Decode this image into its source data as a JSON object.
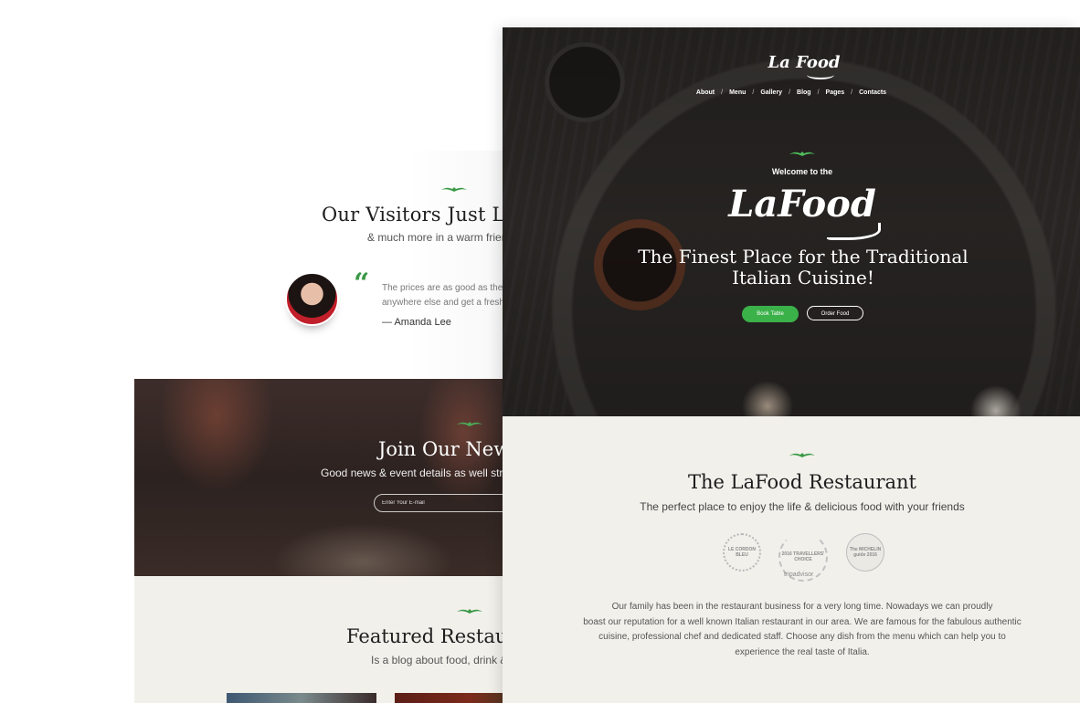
{
  "back": {
    "visitors": {
      "title": "Our Visitors Just Lo",
      "subtitle": "& much more in a warm friend",
      "quote_mark": "“",
      "quote_line1": "The prices are as good as the m",
      "quote_line2": "anywhere else and get a fresh,",
      "author": "— Amanda Lee"
    },
    "newsletter": {
      "title": "Join Our New",
      "subtitle": "Good news & event details as well straig",
      "email_placeholder": "Enter Your E-mail"
    },
    "featured": {
      "title": "Featured Restaur",
      "subtitle": "Is a blog about food, drink & b"
    }
  },
  "front": {
    "logo": "La Food",
    "nav": [
      "About",
      "Menu",
      "Gallery",
      "Blog",
      "Pages",
      "Contacts"
    ],
    "nav_separator": "/",
    "hero": {
      "welcome": "Welcome to the",
      "logo": "LaFood",
      "title_line1": "The Finest Place for the Traditional",
      "title_line2": "Italian Cuisine!",
      "book_label": "Book Table",
      "order_label": "Order Food"
    },
    "about": {
      "title": "The LaFood Restaurant",
      "subtitle": "The perfect place to enjoy the life & delicious food with your friends",
      "awards": {
        "cordon_bleu": "LE CORDON BLEU",
        "tripadvisor_top": "2016 TRAVELLERS' CHOICE",
        "tripadvisor_name": "tripadvisor",
        "michelin": "The MICHELIN guide 2016"
      },
      "body_line1": "Our family has been in the restaurant business for a very long time. Nowadays we can proudly",
      "body_line2": "boast our reputation for a well known Italian restaurant in our area. We are famous for the fabulous authentic",
      "body_line3": "cuisine, professional chef and dedicated staff. Choose any dish from the menu which can help you to",
      "body_line4": "experience the real taste of Italia."
    }
  },
  "colors": {
    "accent_green": "#3bb14a",
    "section_beige": "#f2f0eb",
    "hero_dark": "#2e2b28"
  },
  "icons": [
    "ornament-icon",
    "quote-icon",
    "avatar"
  ]
}
